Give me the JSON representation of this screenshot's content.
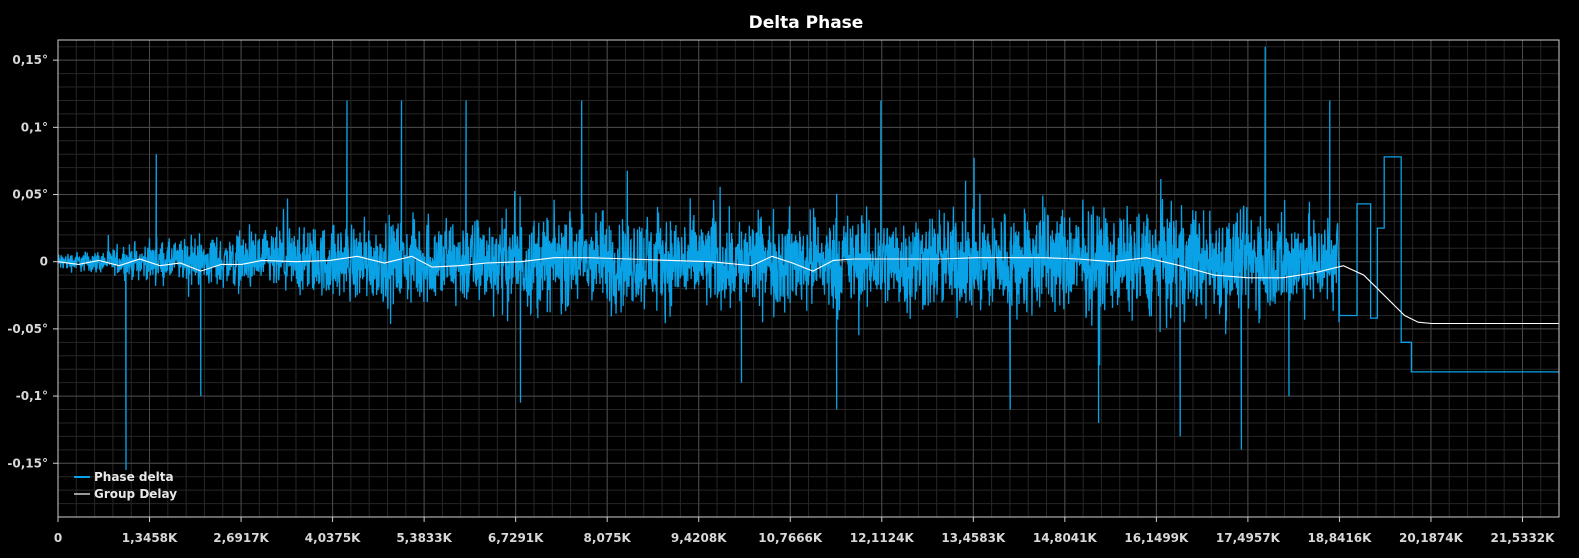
{
  "chart_data": {
    "type": "line",
    "title": "Delta Phase",
    "xlabel": "",
    "ylabel": "",
    "xlim": [
      0,
      22070
    ],
    "ylim": [
      -0.19,
      0.165
    ],
    "grid": true,
    "legend_position": "bottom-left",
    "x_ticks": [
      0,
      1345.8,
      2691.7,
      4037.5,
      5383.3,
      6729.1,
      8075,
      9420.8,
      10766.6,
      12112.4,
      13458.3,
      14804.1,
      16149.9,
      17495.7,
      18841.6,
      20187.4,
      21533.2
    ],
    "x_tick_labels": [
      "0",
      "1,3458K",
      "2,6917K",
      "4,0375K",
      "5,3833K",
      "6,7291K",
      "8,075K",
      "9,4208K",
      "10,7666K",
      "12,1124K",
      "13,4583K",
      "14,8041K",
      "16,1499K",
      "17,4957K",
      "18,8416K",
      "20,1874K",
      "21,5332K"
    ],
    "y_ticks": [
      0.15,
      0.1,
      0.05,
      0,
      -0.05,
      -0.1,
      -0.15
    ],
    "y_tick_labels": [
      "0,15°",
      "0,1°",
      "0,05°",
      "0",
      "-0,05°",
      "-0,1°",
      "-0,15°"
    ],
    "colors": {
      "background": "#000000",
      "plot_border": "#cfcfcf",
      "grid_major": "#4a4a4a",
      "grid_minor": "#262626",
      "phase_delta": "#0aa2e6",
      "group_delay": "#ffffff"
    },
    "series": [
      {
        "name": "Phase delta",
        "color": "#0aa2e6",
        "noise_envelope": {
          "x": [
            0,
            600,
            1345.8,
            2691.7,
            4037.5,
            5383.3,
            6729.1,
            8075,
            9420.8,
            10766.6,
            12112.4,
            13458.3,
            14804.1,
            16149.9,
            17495.7,
            18500,
            19000
          ],
          "amplitude": [
            0.01,
            0.012,
            0.02,
            0.03,
            0.04,
            0.045,
            0.05,
            0.05,
            0.05,
            0.05,
            0.05,
            0.055,
            0.055,
            0.055,
            0.055,
            0.05,
            0.05
          ]
        },
        "spikes": [
          {
            "x": 1000,
            "y": -0.155
          },
          {
            "x": 1445,
            "y": 0.08
          },
          {
            "x": 2100,
            "y": -0.1
          },
          {
            "x": 4250,
            "y": 0.12
          },
          {
            "x": 5050,
            "y": 0.12
          },
          {
            "x": 6000,
            "y": 0.12
          },
          {
            "x": 6800,
            "y": -0.105
          },
          {
            "x": 7700,
            "y": 0.12
          },
          {
            "x": 10050,
            "y": -0.09
          },
          {
            "x": 11450,
            "y": -0.11
          },
          {
            "x": 12100,
            "y": 0.12
          },
          {
            "x": 14000,
            "y": -0.11
          },
          {
            "x": 15300,
            "y": -0.12
          },
          {
            "x": 16500,
            "y": -0.13
          },
          {
            "x": 17400,
            "y": -0.14
          },
          {
            "x": 17750,
            "y": 0.16
          },
          {
            "x": 18100,
            "y": -0.1
          },
          {
            "x": 18700,
            "y": 0.12
          }
        ],
        "tail_steps": [
          {
            "x": 18841.6,
            "y": -0.04
          },
          {
            "x": 19100,
            "y": 0.043
          },
          {
            "x": 19300,
            "y": -0.042
          },
          {
            "x": 19400,
            "y": 0.025
          },
          {
            "x": 19500,
            "y": 0.078
          },
          {
            "x": 19750,
            "y": -0.06
          },
          {
            "x": 19900,
            "y": -0.082
          },
          {
            "x": 22070,
            "y": -0.082
          }
        ]
      },
      {
        "name": "Group Delay",
        "color": "#ffffff",
        "x": [
          0,
          300,
          600,
          900,
          1200,
          1500,
          1800,
          2100,
          2400,
          2700,
          3000,
          3500,
          4000,
          4400,
          4800,
          5200,
          5500,
          5900,
          6300,
          6800,
          7300,
          7800,
          8400,
          9000,
          9600,
          10200,
          10500,
          10800,
          11100,
          11400,
          11700,
          12000,
          12500,
          13000,
          13500,
          14000,
          14500,
          15000,
          15500,
          16000,
          16500,
          17000,
          17500,
          18000,
          18500,
          18900,
          19200,
          19500,
          19800,
          20000,
          20200,
          20500,
          21000,
          21500,
          22070
        ],
        "y": [
          0.0,
          -0.002,
          0.001,
          -0.003,
          0.002,
          -0.003,
          -0.001,
          -0.007,
          -0.002,
          -0.002,
          0.001,
          0.0,
          0.001,
          0.004,
          -0.001,
          0.004,
          -0.004,
          -0.003,
          -0.001,
          0.0,
          0.003,
          0.003,
          0.002,
          0.001,
          0.0,
          -0.003,
          0.004,
          -0.001,
          -0.007,
          0.001,
          0.002,
          0.002,
          0.002,
          0.002,
          0.003,
          0.003,
          0.003,
          0.002,
          0.0,
          0.003,
          -0.003,
          -0.01,
          -0.012,
          -0.012,
          -0.008,
          -0.003,
          -0.01,
          -0.025,
          -0.04,
          -0.045,
          -0.046,
          -0.046,
          -0.046,
          -0.046,
          -0.046
        ]
      }
    ]
  }
}
